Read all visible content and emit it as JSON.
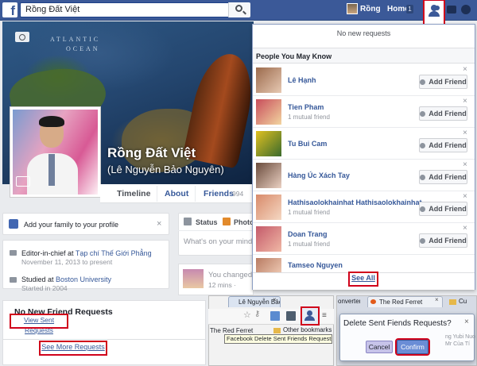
{
  "topbar": {
    "logo": "f",
    "search_value": "Rồng Đất Việt",
    "user_name": "Rồng",
    "home_label": "Home",
    "home_count": "1"
  },
  "cover": {
    "map_text_1": "ATLANTIC",
    "map_text_2": "OCEAN"
  },
  "profile": {
    "name": "Rồng Đất Việt",
    "alternate_name": "(Lê Nguyễn Bảo Nguyên)",
    "tabs": {
      "timeline": "Timeline",
      "about": "About",
      "friends": "Friends",
      "friends_count": "994"
    }
  },
  "left_cards": {
    "family_prompt": "Add your family to your profile",
    "job_prefix": "Editor-in-chief at ",
    "job_place": "Tạp chí Thế Giới Phẳng",
    "job_date": "November 11, 2013 to present",
    "school_prefix": "Studied at ",
    "school_place": "Boston University",
    "school_date": "Started in 2004"
  },
  "composer": {
    "status_label": "Status",
    "photo_label": "Photo",
    "placeholder": "What's on your mind?"
  },
  "story": {
    "text": "You changed",
    "time": "12 mins · "
  },
  "friend_requests": {
    "empty_text": "No new requests",
    "pymk_title": "People You May Know",
    "add_label": "Add Friend",
    "see_all": "See All",
    "people": [
      {
        "name": "Lê Hạnh",
        "mutual": ""
      },
      {
        "name": "Tien Pham",
        "mutual": "1 mutual friend"
      },
      {
        "name": "Tu Bui Cam",
        "mutual": ""
      },
      {
        "name": "Hàng Úc Xách Tay",
        "mutual": ""
      },
      {
        "name": "Hathisaolokhainhat Hathisaolokhainhat",
        "mutual": "1 mutual friend"
      },
      {
        "name": "Doan Trang",
        "mutual": "1 mutual friend"
      },
      {
        "name": "Tamseo Nguyen",
        "mutual": ""
      }
    ]
  },
  "bottom_left": {
    "title": "No New Friend Requests",
    "view_sent": "View Sent Requests",
    "see_more": "See More Requests"
  },
  "bottom_middle": {
    "tab_title": "Lê Nguyễn Bảo",
    "bookmark_left": "The Red Ferret",
    "bookmark_other": "Other bookmarks",
    "tooltip": "Facebook Delete Sent Friends Requests"
  },
  "bottom_right": {
    "tab1": "onverter",
    "tab2": "The Red Ferret",
    "tab3": "Cu",
    "dialog_title": "Delete Sent Fiends Requests?",
    "side_text_1": "ng Yubi Nuo",
    "side_text_2": "Mr Của Tí",
    "cancel": "Cancel",
    "confirm": "Confirm"
  },
  "colors": {
    "brand": "#3b5998",
    "link": "#365899",
    "highlight": "#d0021b"
  }
}
